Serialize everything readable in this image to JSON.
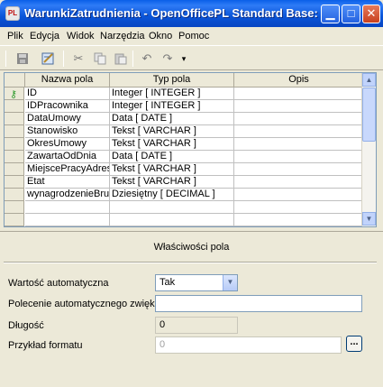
{
  "window": {
    "title": "WarunkiZatrudnienia - OpenOfficePL Standard Base: Pr...",
    "icon_text": "PL"
  },
  "menu": [
    {
      "label": "Plik"
    },
    {
      "label": "Edycja"
    },
    {
      "label": "Widok"
    },
    {
      "label": "Narzędzia"
    },
    {
      "label": "Okno"
    },
    {
      "label": "Pomoc"
    }
  ],
  "toolbar": {
    "icons": [
      "save-icon",
      "edit-design-icon",
      "cut-icon",
      "copy-icon",
      "paste-icon",
      "undo-icon",
      "redo-icon",
      "toolbar-options-icon"
    ]
  },
  "grid": {
    "columns": [
      "Nazwa pola",
      "Typ pola",
      "Opis"
    ],
    "rows": [
      {
        "name": "ID",
        "type": "Integer [ INTEGER ]",
        "desc": "",
        "primary_key": true
      },
      {
        "name": "IDPracownika",
        "type": "Integer [ INTEGER ]",
        "desc": ""
      },
      {
        "name": "DataUmowy",
        "type": "Data [ DATE ]",
        "desc": ""
      },
      {
        "name": "Stanowisko",
        "type": "Tekst [ VARCHAR ]",
        "desc": ""
      },
      {
        "name": "OkresUmowy",
        "type": "Tekst [ VARCHAR ]",
        "desc": ""
      },
      {
        "name": "ZawartaOdDnia",
        "type": "Data [ DATE ]",
        "desc": ""
      },
      {
        "name": "MiejscePracyAdres",
        "type": "Tekst [ VARCHAR ]",
        "desc": ""
      },
      {
        "name": "Etat",
        "type": "Tekst [ VARCHAR ]",
        "desc": ""
      },
      {
        "name": "wynagrodzenieBrutt",
        "type": "Dziesiętny [ DECIMAL ]",
        "desc": ""
      },
      {
        "name": "",
        "type": "",
        "desc": ""
      },
      {
        "name": "",
        "type": "",
        "desc": ""
      },
      {
        "name": "",
        "type": "",
        "desc": ""
      }
    ]
  },
  "properties": {
    "title": "Właściwości pola",
    "auto_value_label": "Wartość automatyczna",
    "auto_value": "Tak",
    "autoincrement_label": "Polecenie automatycznego zwięks",
    "autoincrement_value": "",
    "length_label": "Długość",
    "length_value": "0",
    "format_label": "Przykład formatu",
    "format_value": "0",
    "format_button": "..."
  }
}
